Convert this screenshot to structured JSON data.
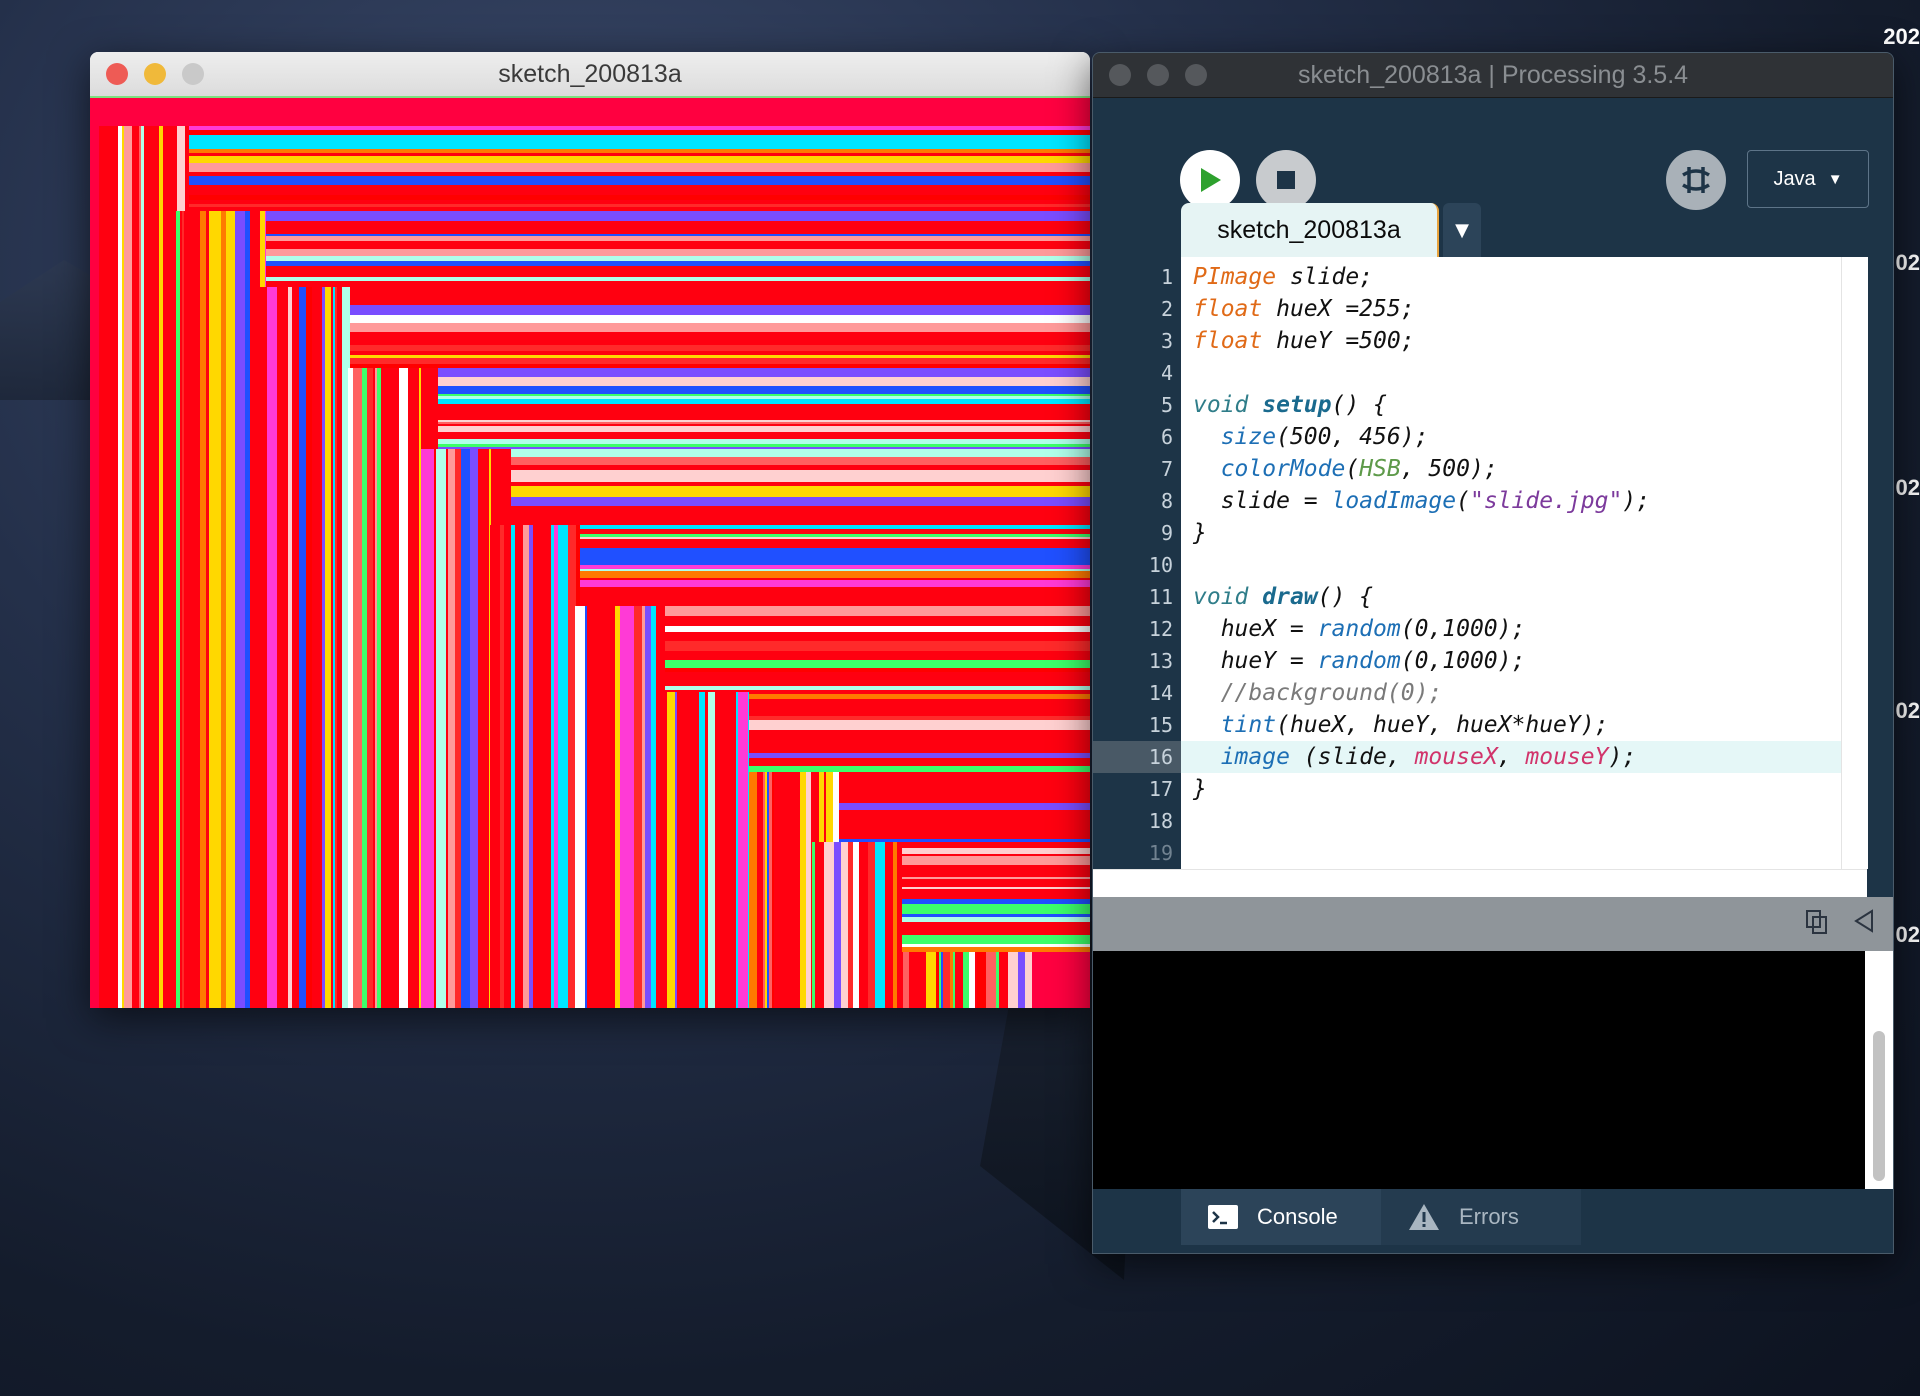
{
  "desktop": {
    "clock_fragments": [
      "202",
      "02",
      "02",
      "02",
      "02"
    ]
  },
  "sketch_window": {
    "title": "sketch_200813a"
  },
  "ide_window": {
    "title": "sketch_200813a | Processing 3.5.4",
    "toolbar": {
      "run_icon": "play-icon",
      "stop_icon": "stop-icon",
      "debug_icon": "debugger-icon",
      "mode_label": "Java",
      "mode_arrow": "▼"
    },
    "tab": {
      "label": "sketch_200813a",
      "menu_arrow": "▼"
    },
    "current_line": 16,
    "code_lines": [
      {
        "n": "1",
        "html": "<span class='kw-type'>PImage</span> slide;"
      },
      {
        "n": "2",
        "html": "<span class='kw-type'>float</span> hueX =255;"
      },
      {
        "n": "3",
        "html": "<span class='kw-type'>float</span> hueY =500;"
      },
      {
        "n": "4",
        "html": ""
      },
      {
        "n": "5",
        "html": "<span class='kw-void'>void</span> <span class='kw-fn'>setup</span>() {"
      },
      {
        "n": "6",
        "html": "  <span class='fn-call'>size</span>(500, 456);"
      },
      {
        "n": "7",
        "html": "  <span class='fn-call'>colorMode</span>(<span class='const'>HSB</span>, 500);"
      },
      {
        "n": "8",
        "html": "  slide = <span class='fn-call'>loadImage</span>(<span class='str'>\"slide.jpg\"</span>);"
      },
      {
        "n": "9",
        "html": "}"
      },
      {
        "n": "10",
        "html": ""
      },
      {
        "n": "11",
        "html": "<span class='kw-void'>void</span> <span class='kw-fn'>draw</span>() {"
      },
      {
        "n": "12",
        "html": "  hueX = <span class='fn-call'>random</span>(0,1000);"
      },
      {
        "n": "13",
        "html": "  hueY = <span class='fn-call'>random</span>(0,1000);"
      },
      {
        "n": "14",
        "html": "  <span class='comment'>//background(0);</span>"
      },
      {
        "n": "15",
        "html": "  <span class='fn-call'>tint</span>(hueX, hueY, hueX*hueY);"
      },
      {
        "n": "16",
        "html": "  <span class='fn-call'>image</span> (slide, <span class='var-p'>mouseX</span>, <span class='var-p'>mouseY</span>);"
      },
      {
        "n": "17",
        "html": "}"
      },
      {
        "n": "18",
        "html": ""
      },
      {
        "n": "19",
        "html": ""
      }
    ],
    "console_header_icons": [
      "copy-icon",
      "collapse-icon"
    ],
    "bottom_tabs": {
      "console_label": "Console",
      "errors_label": "Errors"
    }
  },
  "colors": {
    "canvas_base": "#ff0040",
    "ide_bg": "#1d3447",
    "run_green": "#2da12d"
  }
}
